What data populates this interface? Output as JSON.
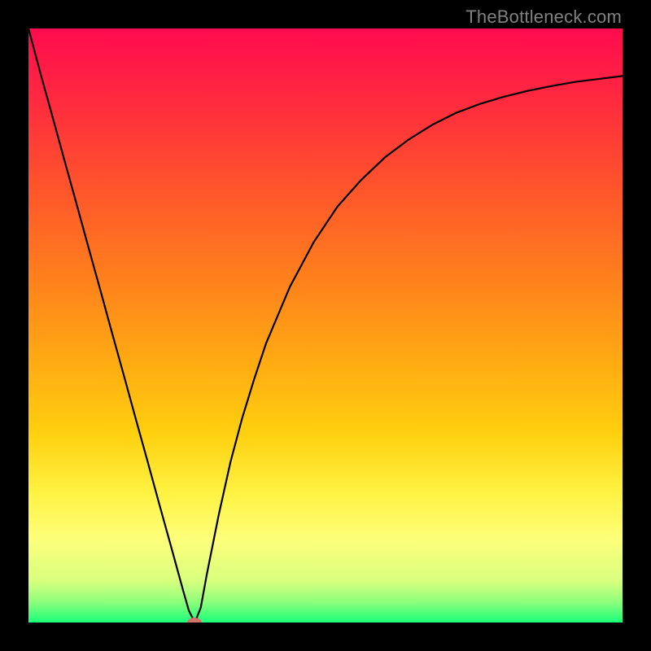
{
  "watermark": "TheBottleneck.com",
  "colors": {
    "frame": "#000000",
    "watermark": "#808080",
    "curve": "#000000",
    "marker": "#d4716b",
    "gradient_stops": [
      {
        "offset": 0.0,
        "color": "#ff0b4e"
      },
      {
        "offset": 0.12,
        "color": "#ff2a3f"
      },
      {
        "offset": 0.25,
        "color": "#ff4f2d"
      },
      {
        "offset": 0.4,
        "color": "#ff7a1e"
      },
      {
        "offset": 0.55,
        "color": "#ffa713"
      },
      {
        "offset": 0.68,
        "color": "#ffcf0e"
      },
      {
        "offset": 0.78,
        "color": "#fff241"
      },
      {
        "offset": 0.86,
        "color": "#fdff7a"
      },
      {
        "offset": 0.93,
        "color": "#d8ff7e"
      },
      {
        "offset": 0.965,
        "color": "#8fff7c"
      },
      {
        "offset": 1.0,
        "color": "#1aff79"
      }
    ]
  },
  "chart_data": {
    "type": "line",
    "title": "",
    "xlabel": "",
    "ylabel": "",
    "xlim": [
      0,
      100
    ],
    "ylim": [
      0,
      100
    ],
    "x": [
      0,
      2,
      4,
      6,
      8,
      10,
      12,
      14,
      16,
      18,
      20,
      22,
      24,
      26,
      27,
      28,
      29,
      30,
      32,
      34,
      36,
      38,
      40,
      44,
      48,
      52,
      56,
      60,
      64,
      68,
      72,
      76,
      80,
      84,
      88,
      92,
      96,
      100
    ],
    "values": [
      100,
      92.5,
      85.3,
      78.0,
      70.8,
      63.5,
      56.3,
      49.0,
      41.8,
      34.5,
      27.3,
      20.0,
      12.8,
      5.5,
      2.0,
      0.0,
      2.5,
      8.0,
      18.0,
      27.0,
      34.5,
      41.0,
      47.0,
      56.5,
      64.0,
      70.0,
      74.5,
      78.3,
      81.3,
      83.8,
      85.8,
      87.3,
      88.5,
      89.5,
      90.3,
      91.0,
      91.5,
      92.0
    ],
    "legend": [],
    "grid": false,
    "annotations": [
      {
        "type": "marker",
        "x": 28,
        "y": 0,
        "shape": "ellipse",
        "color": "#d4716b"
      }
    ]
  }
}
